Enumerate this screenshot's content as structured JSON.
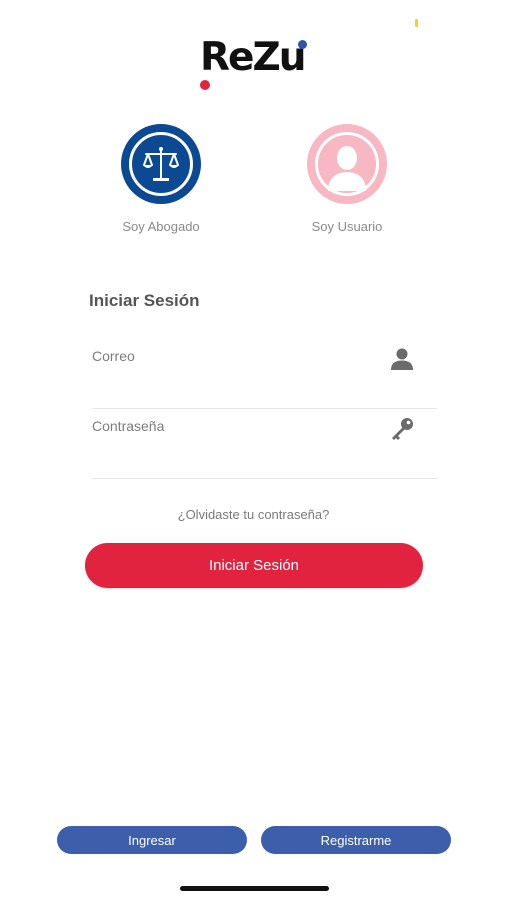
{
  "logo": {
    "text": "ReZu",
    "colors": {
      "text": "#111111",
      "dot_left": "#e0253f",
      "dot_right": "#2d55a8"
    }
  },
  "roles": [
    {
      "label": "Soy Abogado",
      "icon": "scales-of-justice-icon",
      "color": "#0b4a93"
    },
    {
      "label": "Soy Usuario",
      "icon": "person-silhouette-icon",
      "color": "#f7b8c4"
    }
  ],
  "form": {
    "title": "Iniciar Sesión",
    "email": {
      "placeholder": "Correo",
      "value": "",
      "icon": "user-icon"
    },
    "password": {
      "placeholder": "Contraseña",
      "value": "",
      "icon": "key-icon"
    },
    "forgot_label": "¿Olvidaste tu contraseña?",
    "submit_label": "Iniciar Sesión"
  },
  "bottom_nav": {
    "login_label": "Ingresar",
    "register_label": "Registrarme"
  },
  "colors": {
    "primary_red": "#e2233f",
    "secondary_blue": "#3d5eab"
  }
}
